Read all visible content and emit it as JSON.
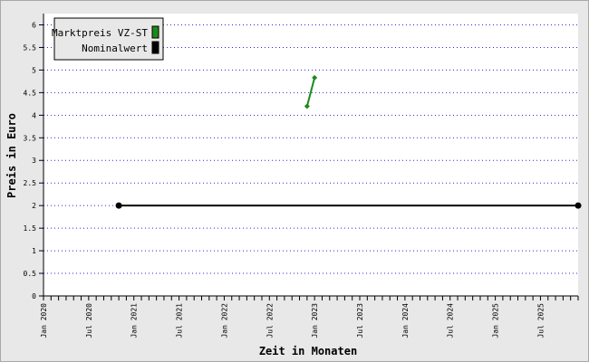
{
  "chart_data": {
    "type": "line",
    "xlabel": "Zeit in Monaten",
    "ylabel": "Preis in Euro",
    "ylim": [
      0,
      6.25
    ],
    "xlim": [
      "2020-01",
      "2025-12"
    ],
    "y_ticks": [
      "0",
      "0.5",
      "1",
      "1.5",
      "2",
      "2.5",
      "3",
      "3.5",
      "4",
      "4.5",
      "5",
      "5.5",
      "6"
    ],
    "x_ticks": [
      {
        "label": "Jan 2020",
        "date": "2020-01"
      },
      {
        "label": "Jul 2020",
        "date": "2020-07"
      },
      {
        "label": "Jan 2021",
        "date": "2021-01"
      },
      {
        "label": "Jul 2021",
        "date": "2021-07"
      },
      {
        "label": "Jan 2022",
        "date": "2022-01"
      },
      {
        "label": "Jul 2022",
        "date": "2022-07"
      },
      {
        "label": "Jan 2023",
        "date": "2023-01"
      },
      {
        "label": "Jul 2023",
        "date": "2023-07"
      },
      {
        "label": "Jan 2024",
        "date": "2024-01"
      },
      {
        "label": "Jul 2024",
        "date": "2024-07"
      },
      {
        "label": "Jan 2025",
        "date": "2025-01"
      },
      {
        "label": "Jul 2025",
        "date": "2025-07"
      }
    ],
    "grid": true,
    "legend_position": "top-left",
    "series": [
      {
        "name": "Marktpreis VZ-ST",
        "color": "#1a8a1a",
        "points": [
          {
            "x": "2022-12",
            "y": 4.2
          },
          {
            "x": "2023-01",
            "y": 4.83
          }
        ]
      },
      {
        "name": "Nominalwert",
        "color": "#000000",
        "points": [
          {
            "x": "2020-11",
            "y": 2
          },
          {
            "x": "2025-12",
            "y": 2
          }
        ]
      }
    ]
  }
}
